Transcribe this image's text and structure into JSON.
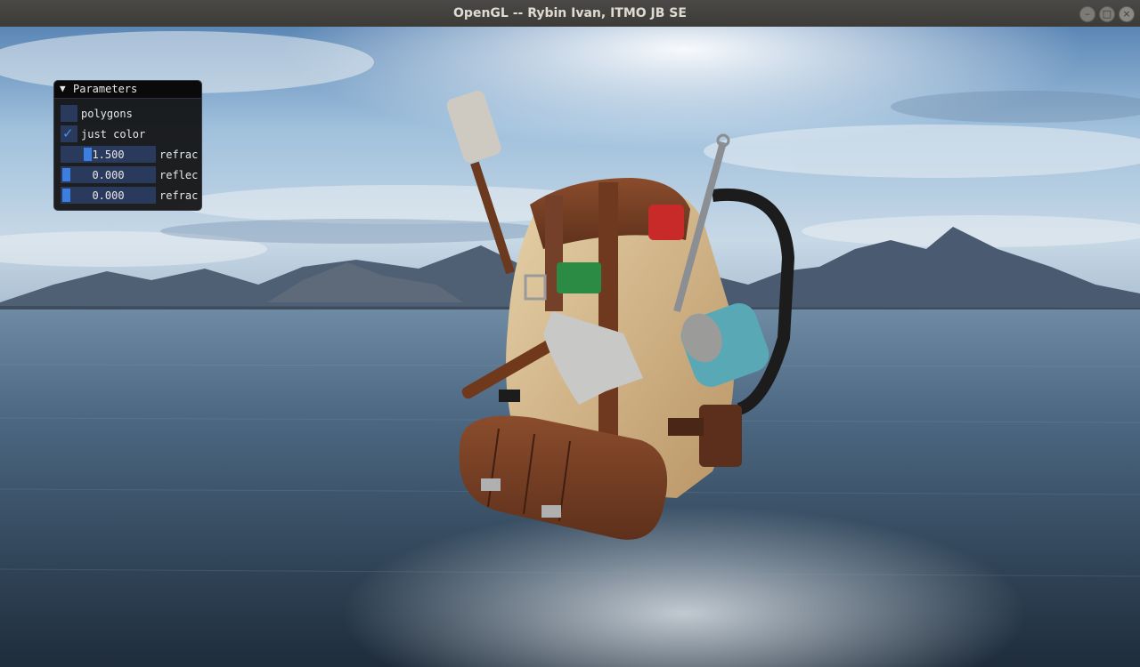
{
  "window": {
    "title": "OpenGL -- Rybin Ivan, ITMO JB SE",
    "buttons": {
      "minimize": "–",
      "maximize": "□",
      "close": "×"
    }
  },
  "panel": {
    "title": "Parameters",
    "collapse_arrow": "▼",
    "checkboxes": [
      {
        "label": "polygons",
        "checked": false
      },
      {
        "label": "just color",
        "checked": true,
        "mark": "✓"
      }
    ],
    "sliders": [
      {
        "value": "1.500",
        "label": "refrac",
        "fill_fraction": 0.25
      },
      {
        "value": "0.000",
        "label": "reflec",
        "fill_fraction": 0.0
      },
      {
        "value": "0.000",
        "label": "refrac",
        "fill_fraction": 0.0
      }
    ]
  },
  "scene": {
    "description_icon": "backpack-model-icon",
    "colors": {
      "sky": "#9fc0dc",
      "water": "#3d566e",
      "accent": "#3d7fe0"
    }
  }
}
